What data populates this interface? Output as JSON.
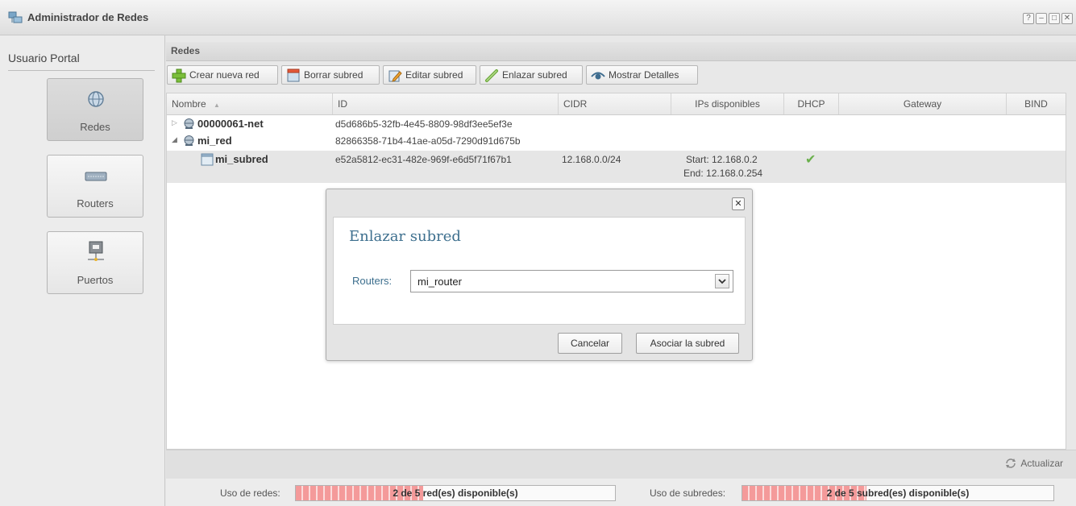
{
  "window": {
    "title": "Administrador de Redes",
    "controls": [
      "?",
      "–",
      "□",
      "✕"
    ]
  },
  "sidebar": {
    "title": "Usuario Portal",
    "items": [
      {
        "label": "Redes",
        "icon": "globe-icon",
        "active": true
      },
      {
        "label": "Routers",
        "icon": "router-icon",
        "active": false
      },
      {
        "label": "Puertos",
        "icon": "port-icon",
        "active": false
      }
    ]
  },
  "panel": {
    "title": "Redes"
  },
  "toolbar": {
    "buttons": [
      {
        "label": "Crear nueva red",
        "icon": "plus-icon"
      },
      {
        "label": "Borrar subred",
        "icon": "delete-subnet-icon"
      },
      {
        "label": "Editar subred",
        "icon": "edit-icon"
      },
      {
        "label": "Enlazar subred",
        "icon": "link-icon"
      },
      {
        "label": "Mostrar Detalles",
        "icon": "eye-icon"
      }
    ]
  },
  "grid": {
    "columns": [
      "Nombre",
      "ID",
      "CIDR",
      "IPs disponibles",
      "DHCP",
      "Gateway",
      "BIND"
    ],
    "sort_indicator": "▲",
    "rows": [
      {
        "name": "00000061-net",
        "id": "d5d686b5-32fb-4e45-8809-98df3ee5ef3e",
        "expander": "▷"
      },
      {
        "name": "mi_red",
        "id": "82866358-71b4-41ae-a05d-7290d91d675b",
        "expander": "◢"
      },
      {
        "name": "mi_subred",
        "id": "e52a5812-ec31-482e-969f-e6d5f71f67b1",
        "cidr": "12.168.0.0/24",
        "ips_start": "Start: 12.168.0.2",
        "ips_end": "End: 12.168.0.254",
        "dhcp": "✔"
      }
    ]
  },
  "footer": {
    "refresh_label": "Actualizar"
  },
  "status": {
    "networks_label": "Uso de redes:",
    "networks_text": "2 de 5 red(es) disponible(s)",
    "networks_fraction": 0.4,
    "subnets_label": "Uso de subredes:",
    "subnets_text": "2 de 5 subred(es) disponible(s)",
    "subnets_fraction": 0.4
  },
  "dialog": {
    "close": "✕",
    "title": "Enlazar subred",
    "field_label": "Routers:",
    "field_value": "mi_router",
    "cancel_label": "Cancelar",
    "submit_label": "Asociar la subred"
  },
  "colors": {
    "accent_text": "#3d6f8e",
    "usage_fill": "#f49a9a",
    "dhcp_check": "#6ab04c"
  }
}
